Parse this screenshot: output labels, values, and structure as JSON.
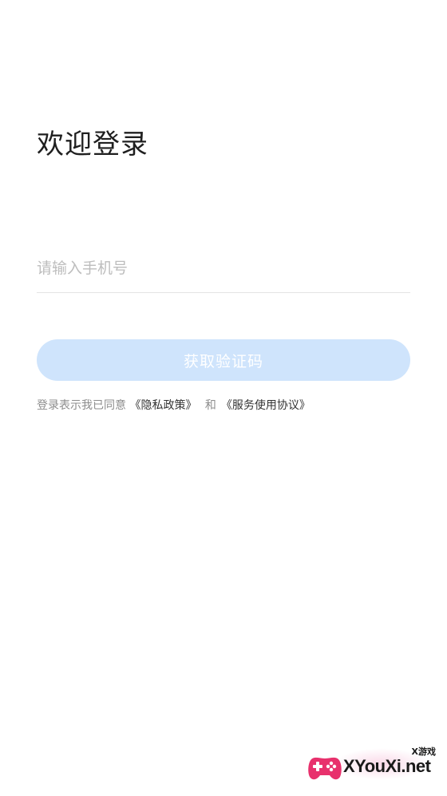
{
  "login": {
    "title": "欢迎登录",
    "phone_placeholder": "请输入手机号",
    "phone_value": "",
    "get_code_label": "获取验证码",
    "agreement": {
      "prefix": "登录表示我已同意",
      "privacy_link": "《隐私政策》",
      "conjunction": "和",
      "terms_link": "《服务使用协议》"
    }
  },
  "watermark": {
    "sub": "X游戏",
    "main": "XYouXi.net",
    "logo_icon": "gamepad-icon"
  },
  "colors": {
    "button_bg": "#cfe4fc",
    "button_text": "#ffffff",
    "title_text": "#1f1f1f",
    "placeholder": "#bdbdbd",
    "muted_text": "#8c8c8c",
    "link_text": "#333333",
    "divider": "#e4e4e4"
  }
}
